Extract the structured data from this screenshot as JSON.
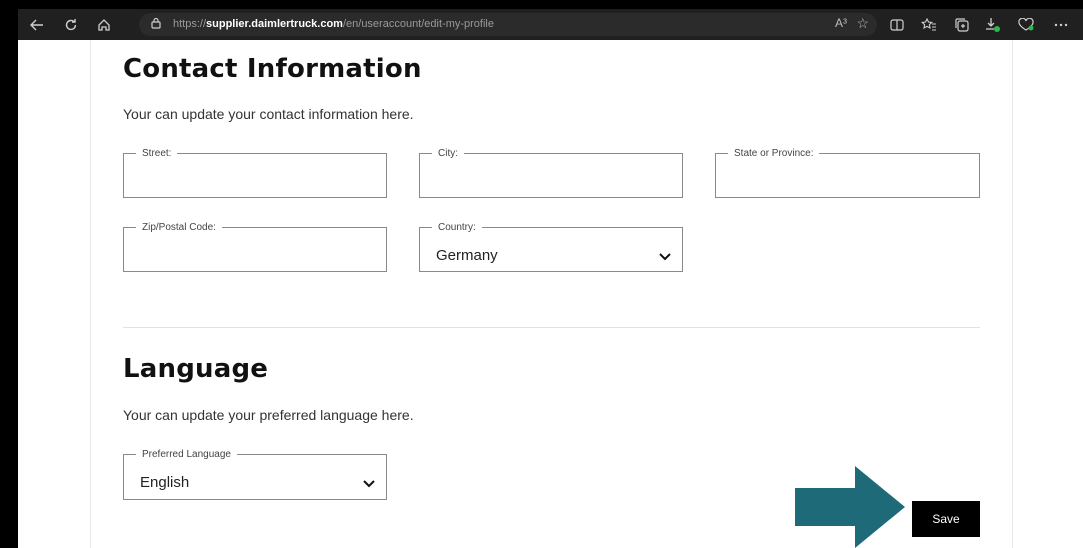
{
  "browser": {
    "url_prefix": "https://",
    "url_domain": "supplier.daimlertruck.com",
    "url_path": "/en/useraccount/edit-my-profile",
    "read_aloud": "A³"
  },
  "contact": {
    "title": "Contact Information",
    "description": "Your can update your contact information here.",
    "street_label": "Street:",
    "street_value": "",
    "city_label": "City:",
    "city_value": "",
    "state_label": "State or Province:",
    "state_value": "",
    "zip_label": "Zip/Postal Code:",
    "zip_value": "",
    "country_label": "Country:",
    "country_value": "Germany"
  },
  "language": {
    "title": "Language",
    "description": "Your can update your preferred language here.",
    "preferred_label": "Preferred Language",
    "preferred_value": "English"
  },
  "save_label": "Save",
  "colors": {
    "arrow": "#1e6a78",
    "save_bg": "#000000"
  }
}
